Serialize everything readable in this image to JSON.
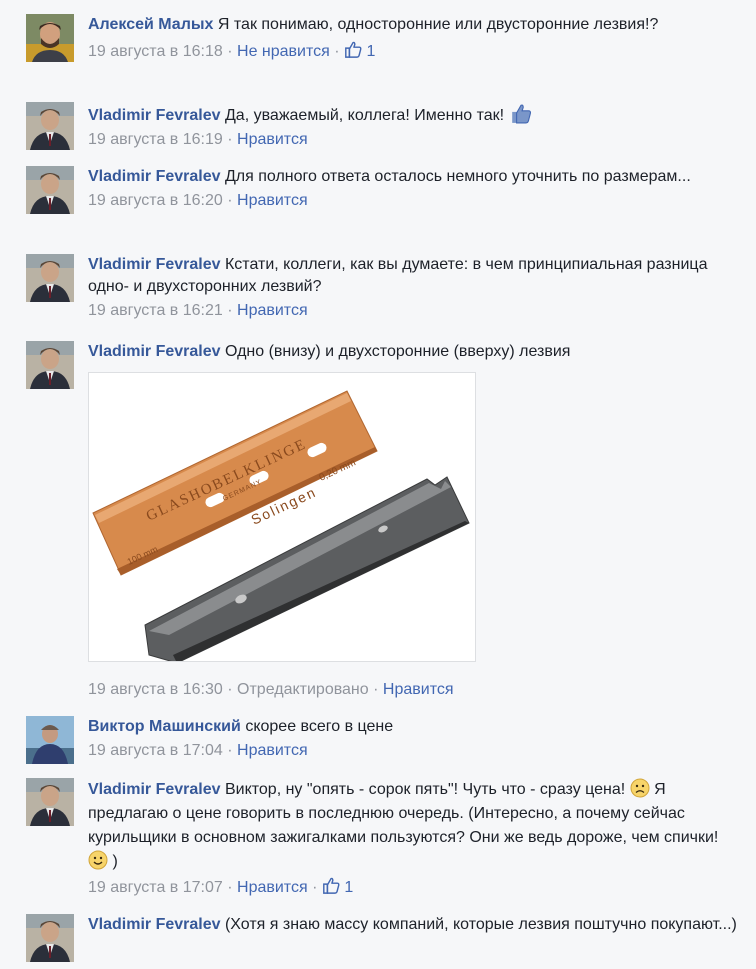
{
  "comments": [
    {
      "author": "Алексей Малых",
      "text": "Я так понимаю, односторонние или двусторонние лезвия!?",
      "time": "19 августа в 16:18",
      "action": "Не нравится",
      "likes": "1"
    },
    {
      "author": "Vladimir Fevralev",
      "text": "Да, уважаемый, коллега! Именно так!",
      "time": "19 августа в 16:19",
      "action": "Нравится"
    },
    {
      "author": "Vladimir Fevralev",
      "text": "Для полного ответа осталось немного уточнить по размерам...",
      "time": "19 августа в 16:20",
      "action": "Нравится"
    },
    {
      "author": "Vladimir Fevralev",
      "text": "Кстати, коллеги, как вы думаете: в чем принципиальная разница одно- и двухсторонних лезвий?",
      "time": "19 августа в 16:21",
      "action": "Нравится"
    },
    {
      "author": "Vladimir Fevralev",
      "text": "Одно (внизу) и двухсторонние (вверху) лезвия",
      "time": "19 августа в 16:30",
      "edited": "Отредактировано",
      "action": "Нравится"
    },
    {
      "author": "Виктор Машинский",
      "text": "скорее всего в цене",
      "time": "19 августа в 17:04",
      "action": "Нравится"
    },
    {
      "author": "Vladimir Fevralev",
      "text_part1": "Виктор, ну \"опять - сорок пять\"! Чуть что - сразу цена!",
      "text_part2": "Я предлагаю о цене говорить в последнюю очередь. (Интересно, а почему сейчас курильщики в основном зажигалками пользуются? Они же ведь дороже, чем спички!",
      "text_part3": ")",
      "time": "19 августа в 17:07",
      "action": "Нравится",
      "likes": "1"
    },
    {
      "author": "Vladimir Fevralev",
      "text": "(Хотя я знаю массу компаний, которые лезвия поштучно покупают...)"
    }
  ],
  "photo": {
    "blade_top_text": "GLASHOBELKLINGE",
    "blade_brand": "Solingen",
    "blade_size_mm": "100 mm",
    "blade_thickness": "0,20 mm",
    "blade_germany": "GERMANY"
  },
  "colors": {
    "author": "#365899",
    "link": "#4267b2",
    "meta": "#90949c",
    "background": "#f6f7f9",
    "copper_blade": "#d4884a",
    "steel_blade": "#5a5c5e"
  },
  "icons": [
    "thumbs-up-icon",
    "sad-face-icon",
    "smile-face-icon"
  ]
}
